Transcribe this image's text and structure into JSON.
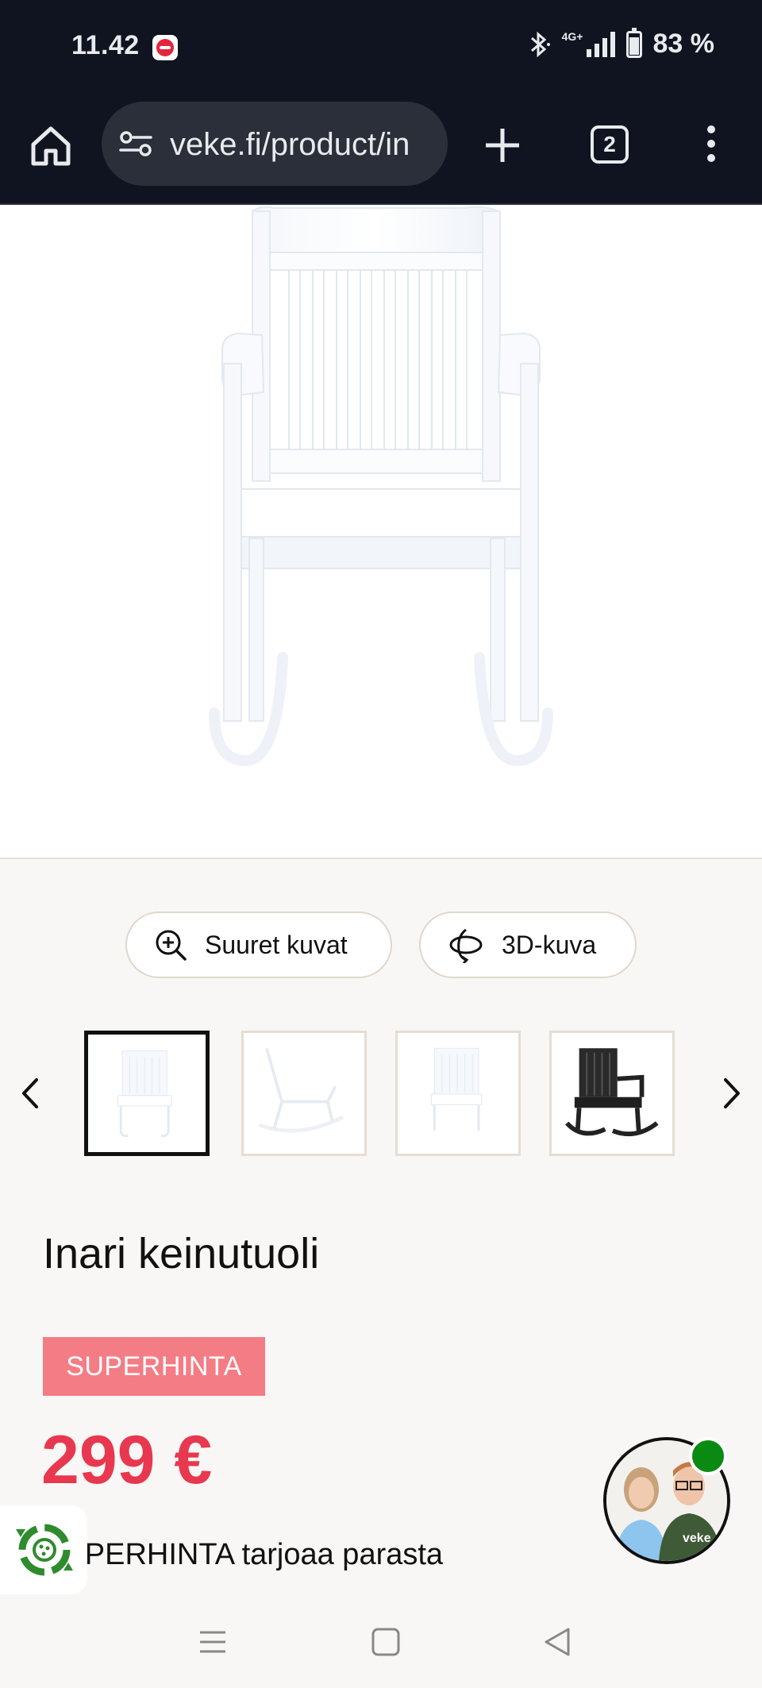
{
  "status_bar": {
    "time": "11.42",
    "network": "4G+",
    "battery": "83 %",
    "icons": [
      "notification-app-icon",
      "bluetooth-icon",
      "signal-icon",
      "battery-icon"
    ]
  },
  "browser": {
    "url": "veke.fi/product/in",
    "tab_count": "2",
    "icons": [
      "home-icon",
      "site-settings-icon",
      "new-tab-icon",
      "tabs-icon",
      "more-vert-icon"
    ]
  },
  "gallery": {
    "large_images_label": "Suuret kuvat",
    "view_3d_label": "3D-kuva",
    "thumbnails": [
      "white-chair-front",
      "white-chair-side",
      "white-chair-front-2",
      "black-chair"
    ],
    "selected_index": 0
  },
  "product": {
    "title": "Inari keinutuoli",
    "badge": "SUPERHINTA",
    "price": "299 €",
    "description": "SUPERHINTA tarjoaa parasta"
  },
  "colors": {
    "badge_bg": "#f47c85",
    "price": "#e8384f",
    "online_dot": "#0a8a12",
    "eco_green": "#2e8b2e"
  },
  "nav": {
    "icons": [
      "recent-apps-icon",
      "home-button-icon",
      "back-icon"
    ]
  }
}
